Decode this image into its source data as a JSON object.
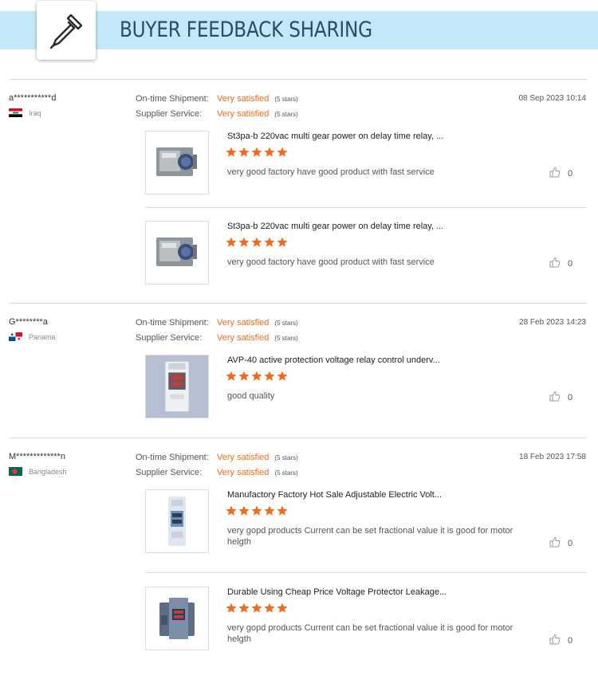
{
  "header": {
    "title": "BUYER FEEDBACK SHARING",
    "logo_icon": "eyedropper-icon",
    "accent": "#c3e9f8"
  },
  "labels": {
    "shipment": "On-time Shipment:",
    "service": "Supplier Service:"
  },
  "colors": {
    "orange": "#f26a1b"
  },
  "reviews": [
    {
      "buyer": "a***********d",
      "country": "Iraq",
      "date": "08 Sep 2023 10:14",
      "shipment": "Very satisfied",
      "shipment_stars": "(5 stars)",
      "service": "Very satisfied",
      "service_stars": "(5 stars)",
      "items": [
        {
          "title": "St3pa-b 220vac multi gear power on delay time relay, ...",
          "rating": 5,
          "comment": "very good factory have good product with fast service",
          "likes": "0"
        },
        {
          "title": "St3pa-b 220vac multi gear power on delay time relay, ...",
          "rating": 5,
          "comment": "very good factory have good product with fast service",
          "likes": "0"
        }
      ]
    },
    {
      "buyer": "G********a",
      "country": "Panama",
      "date": "28 Feb 2023 14:23",
      "shipment": "Very satisfied",
      "shipment_stars": "(5 stars)",
      "service": "Very satisfied",
      "service_stars": "(5 stars)",
      "items": [
        {
          "title": "AVP-40 active protection voltage relay control underv...",
          "rating": 5,
          "comment": "good quality",
          "likes": "0"
        }
      ]
    },
    {
      "buyer": "M*************n",
      "country": "Bangladesh",
      "date": "18 Feb 2023 17:58",
      "shipment": "Very satisfied",
      "shipment_stars": "(5 stars)",
      "service": "Very satisfied",
      "service_stars": "(5 stars)",
      "items": [
        {
          "title": "Manufactory Factory Hot Sale Adjustable Electric Volt...",
          "rating": 5,
          "comment": "very gopd products Current can be set fractional value it is good for motor helgth",
          "likes": "0"
        },
        {
          "title": "Durable Using Cheap Price Voltage Protector Leakage...",
          "rating": 5,
          "comment": "very gopd products Current can be set fractional value it is good for motor helgth",
          "likes": "0"
        }
      ]
    }
  ]
}
